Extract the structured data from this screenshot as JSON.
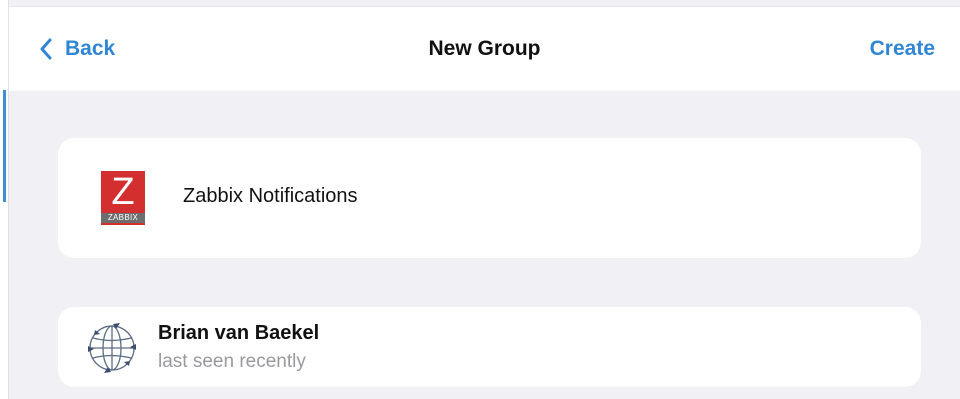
{
  "nav": {
    "back_label": "Back",
    "title": "New Group",
    "create_label": "Create"
  },
  "group": {
    "name": "Zabbix Notifications",
    "logo_letter": "Z",
    "logo_text": "ZABBIX"
  },
  "members": [
    {
      "name": "Brian van Baekel",
      "status": "last seen recently",
      "avatar_icon": "globe-icon"
    }
  ],
  "colors": {
    "accent": "#2f86d4",
    "background": "#f0f0f5",
    "logo_red": "#d32f2f",
    "secondary_text": "#9a9a9e"
  }
}
